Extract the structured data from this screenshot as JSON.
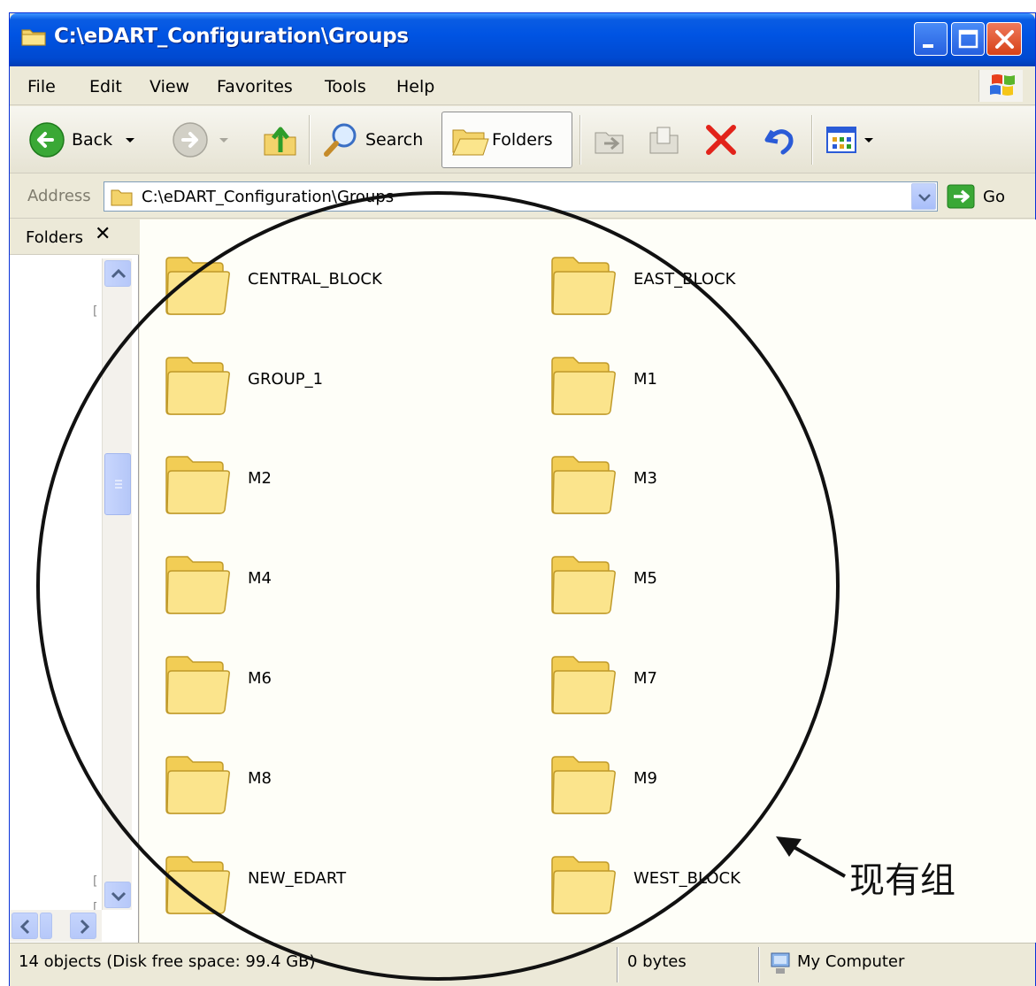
{
  "window": {
    "title": "C:\\eDART_Configuration\\Groups",
    "controls": [
      "minimize",
      "maximize",
      "close"
    ]
  },
  "menu": [
    "File",
    "Edit",
    "View",
    "Favorites",
    "Tools",
    "Help"
  ],
  "toolbar": {
    "back_label": "Back",
    "search_label": "Search",
    "folders_label": "Folders"
  },
  "address": {
    "label": "Address",
    "path": "C:\\eDART_Configuration\\Groups",
    "go_label": "Go"
  },
  "folders_pane": {
    "title": "Folders",
    "close_glyph": "✕"
  },
  "folders": [
    "CENTRAL_BLOCK",
    "EAST_BLOCK",
    "GROUP_1",
    "M1",
    "M2",
    "M3",
    "M4",
    "M5",
    "M6",
    "M7",
    "M8",
    "M9",
    "NEW_EDART",
    "WEST_BLOCK"
  ],
  "status": {
    "objects": "14 objects (Disk free space: 99.4 GB)",
    "size": "0 bytes",
    "location": "My Computer"
  },
  "annotation": {
    "label": "现有组"
  },
  "colors": {
    "titlebar": "#0054e3",
    "chrome": "#ece9d8",
    "content_bg": "#fefef8",
    "folder_yellow": "#f7d96a"
  }
}
